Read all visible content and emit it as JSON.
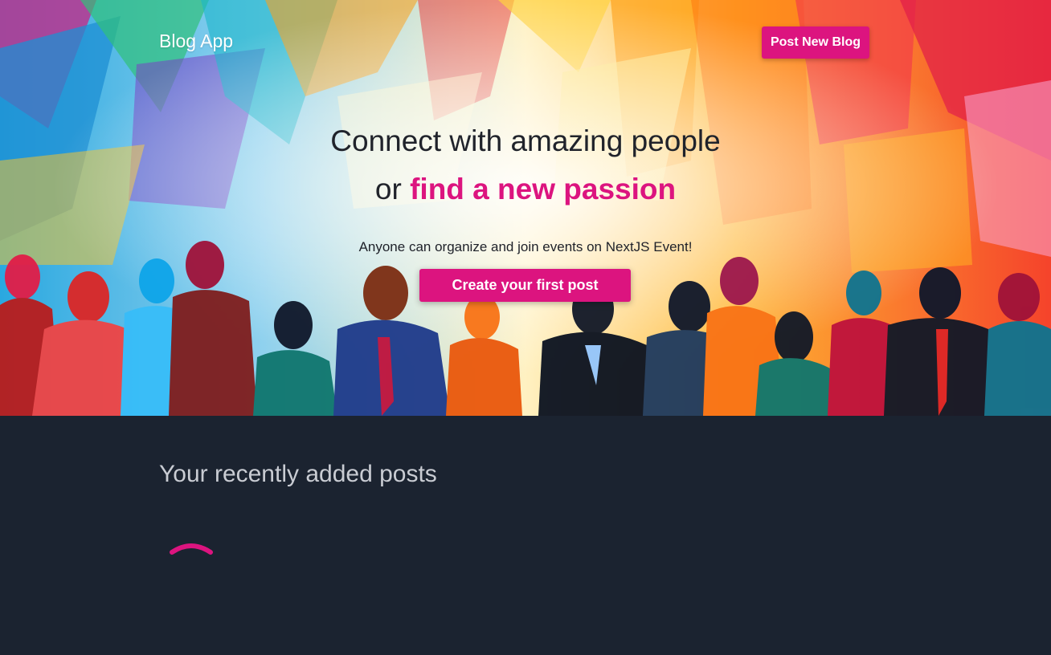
{
  "nav": {
    "brand": "Blog App",
    "post_button_label": "Post New Blog"
  },
  "hero": {
    "title_line1": "Connect with amazing people",
    "title_line2_prefix": "or ",
    "title_line2_accent": "find a new passion",
    "subtitle": "Anyone can organize and join events on NextJS Event!",
    "cta_label": "Create your first post"
  },
  "posts": {
    "heading": "Your recently added posts",
    "loading_icon": "spinner-icon"
  },
  "colors": {
    "accent": "#dc147f",
    "section_background": "#1b2330",
    "heading_text": "#c9ccd3"
  }
}
